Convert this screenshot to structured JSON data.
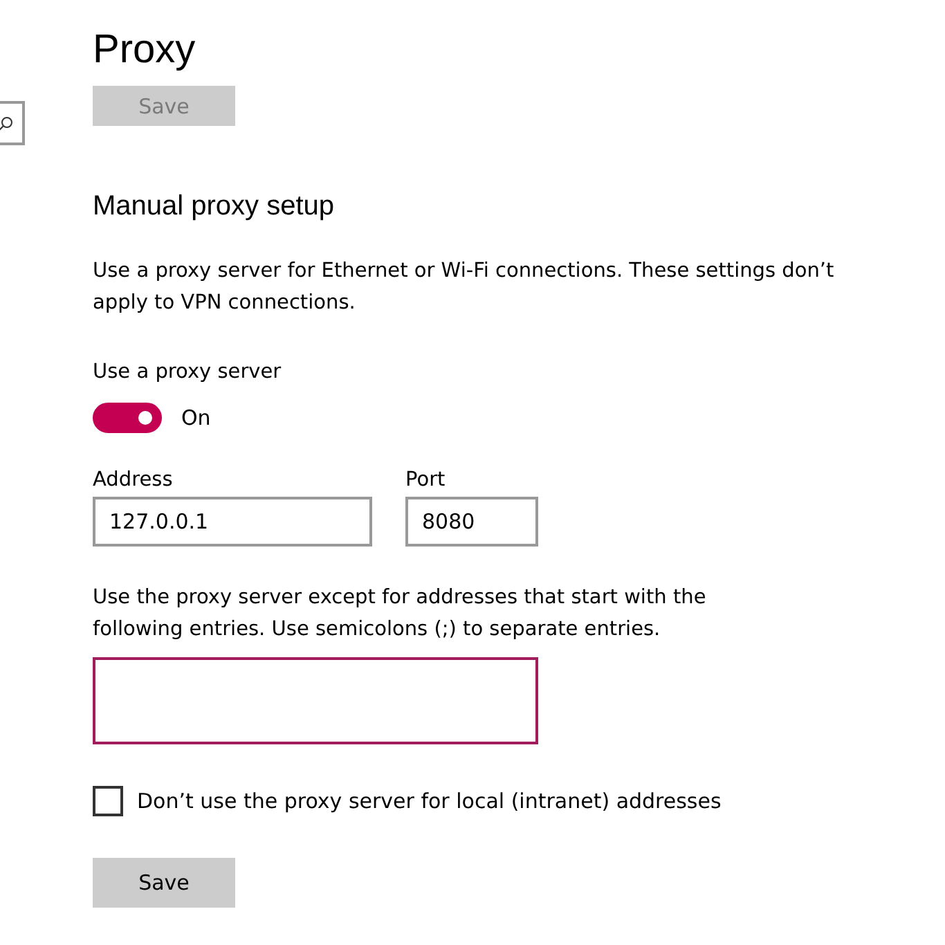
{
  "title": "Proxy",
  "top_save": {
    "label": "Save",
    "disabled": true
  },
  "section_heading": "Manual proxy setup",
  "description": "Use a proxy server for Ethernet or Wi-Fi connections. These settings don’t apply to VPN connections.",
  "use_proxy": {
    "label": "Use a proxy server",
    "on": true,
    "state_text": "On"
  },
  "address": {
    "label": "Address",
    "value": "127.0.0.1"
  },
  "port": {
    "label": "Port",
    "value": "8080"
  },
  "exceptions": {
    "label": "Use the proxy server except for addresses that start with the following entries. Use semicolons (;) to separate entries.",
    "focused": true
  },
  "bypass_local": {
    "label": "Don’t use the proxy server for local (intranet) addresses",
    "checked": false
  },
  "bottom_save": {
    "label": "Save",
    "disabled": false
  }
}
